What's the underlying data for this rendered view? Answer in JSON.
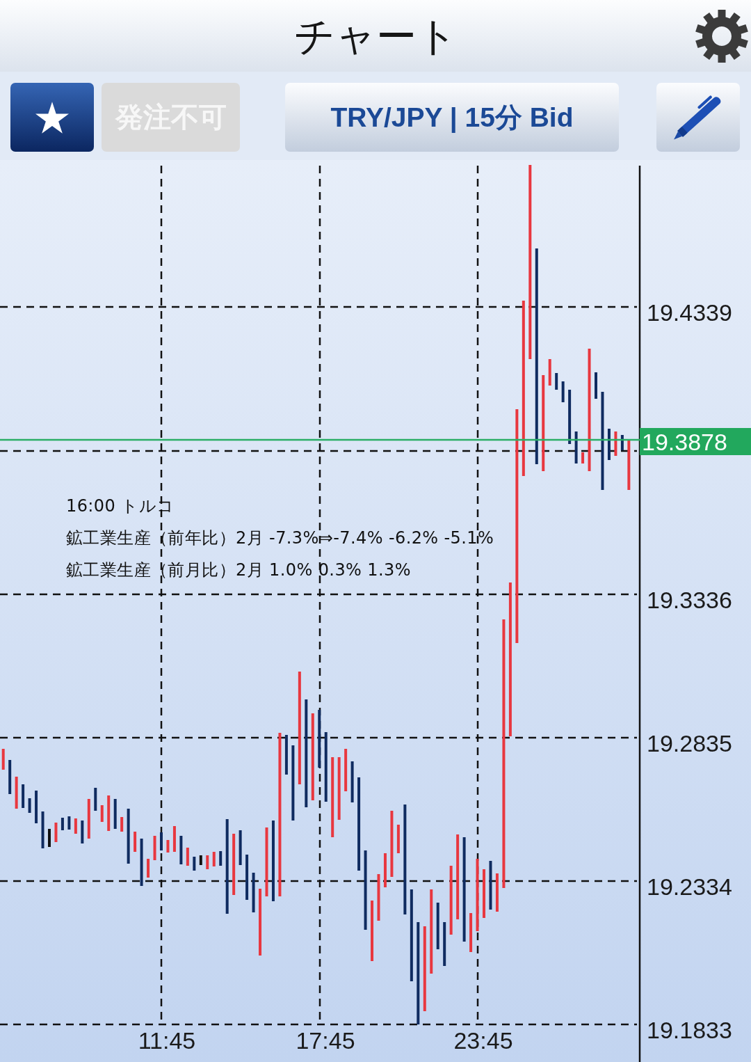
{
  "header": {
    "title": "チャート"
  },
  "toolbar": {
    "order_button": {
      "label": "発注不可",
      "disabled": true
    },
    "symbol_button": {
      "label": "TRY/JPY | 15分 Bid"
    }
  },
  "chart": {
    "price_labels": [
      "19.4339",
      "19.3336",
      "19.2835",
      "19.2334",
      "19.1833"
    ],
    "current_price": "19.3878",
    "time_labels": [
      "11:45",
      "17:45",
      "23:45"
    ],
    "event_note": [
      "16:00 トルコ",
      "鉱工業生産（前年比）2月 -7.3%⇒-7.4% -6.2% -5.1%",
      "鉱工業生産（前月比）2月 1.0% 0.3% 1.3%"
    ]
  }
}
